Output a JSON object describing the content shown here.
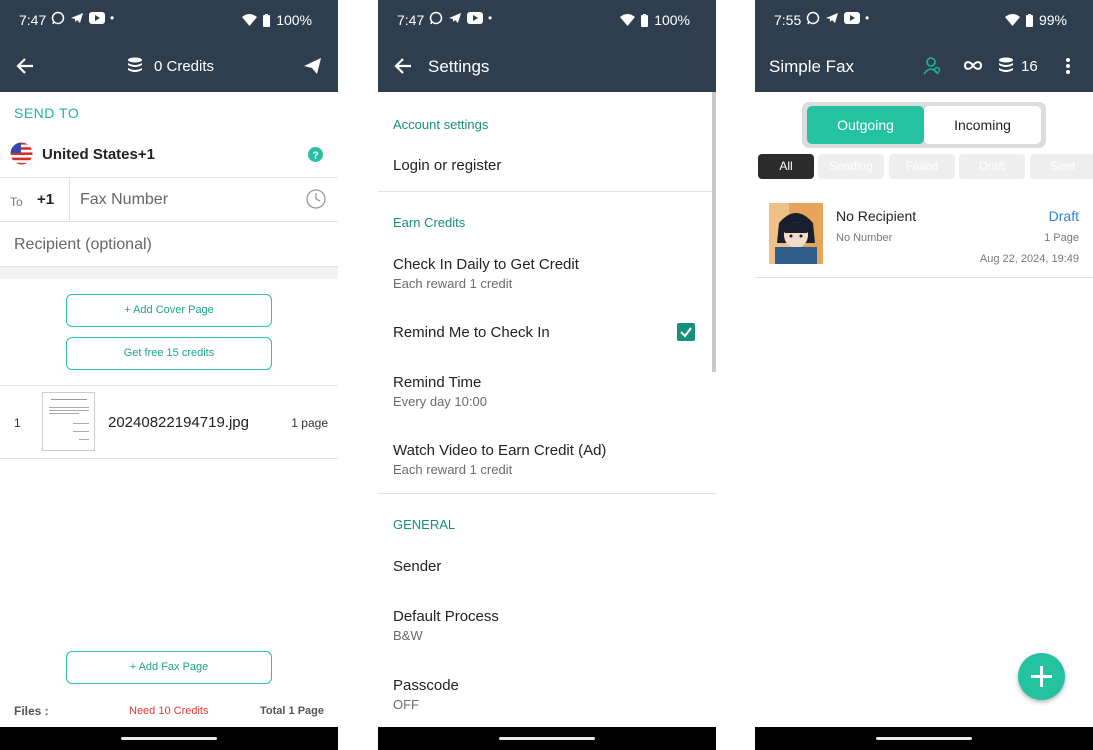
{
  "screen1": {
    "status": {
      "time": "7:47",
      "battery": "100%"
    },
    "appbar": {
      "credits": "0 Credits"
    },
    "send_to": "SEND TO",
    "country": "United States+1",
    "to_label": "To",
    "dial_code": "+1",
    "fax_placeholder": "Fax Number",
    "recipient_placeholder": "Recipient (optional)",
    "add_cover": "+ Add Cover Page",
    "free_credits": "Get free 15 credits",
    "file": {
      "index": "1",
      "name": "20240822194719.jpg",
      "pages": "1 page"
    },
    "add_fax_page": "+ Add Fax Page",
    "footer": {
      "files": "Files :",
      "need": "Need 10 Credits",
      "total": "Total 1 Page"
    },
    "colors": {
      "bar": "#2f3e4e",
      "accent": "#1eb69a",
      "warn": "#e53935"
    }
  },
  "screen2": {
    "status": {
      "time": "7:47",
      "battery": "100%"
    },
    "title": "Settings",
    "sections": {
      "account": "Account settings",
      "login": "Login or register",
      "earn": "Earn Credits",
      "checkin": "Check In Daily to Get Credit",
      "checkin_sub": "Each reward 1 credit",
      "remind": "Remind Me to Check In",
      "remind_time": "Remind Time",
      "remind_time_sub": "Every day 10:00",
      "watch": "Watch Video to Earn Credit (Ad)",
      "watch_sub": "Each reward 1 credit",
      "general": "GENERAL",
      "sender": "Sender",
      "process": "Default Process",
      "process_sub": "B&W",
      "passcode": "Passcode",
      "passcode_sub": "OFF"
    }
  },
  "screen3": {
    "status": {
      "time": "7:55",
      "battery": "99%"
    },
    "title": "Simple Fax",
    "credits": "16",
    "tabs": {
      "outgoing": "Outgoing",
      "incoming": "Incoming"
    },
    "filters": [
      "All",
      "Sending",
      "Failed",
      "Draft",
      "Sent"
    ],
    "item": {
      "recipient": "No Recipient",
      "status": "Draft",
      "number": "No Number",
      "pages": "1 Page",
      "date": "Aug 22, 2024, 19:49"
    }
  }
}
